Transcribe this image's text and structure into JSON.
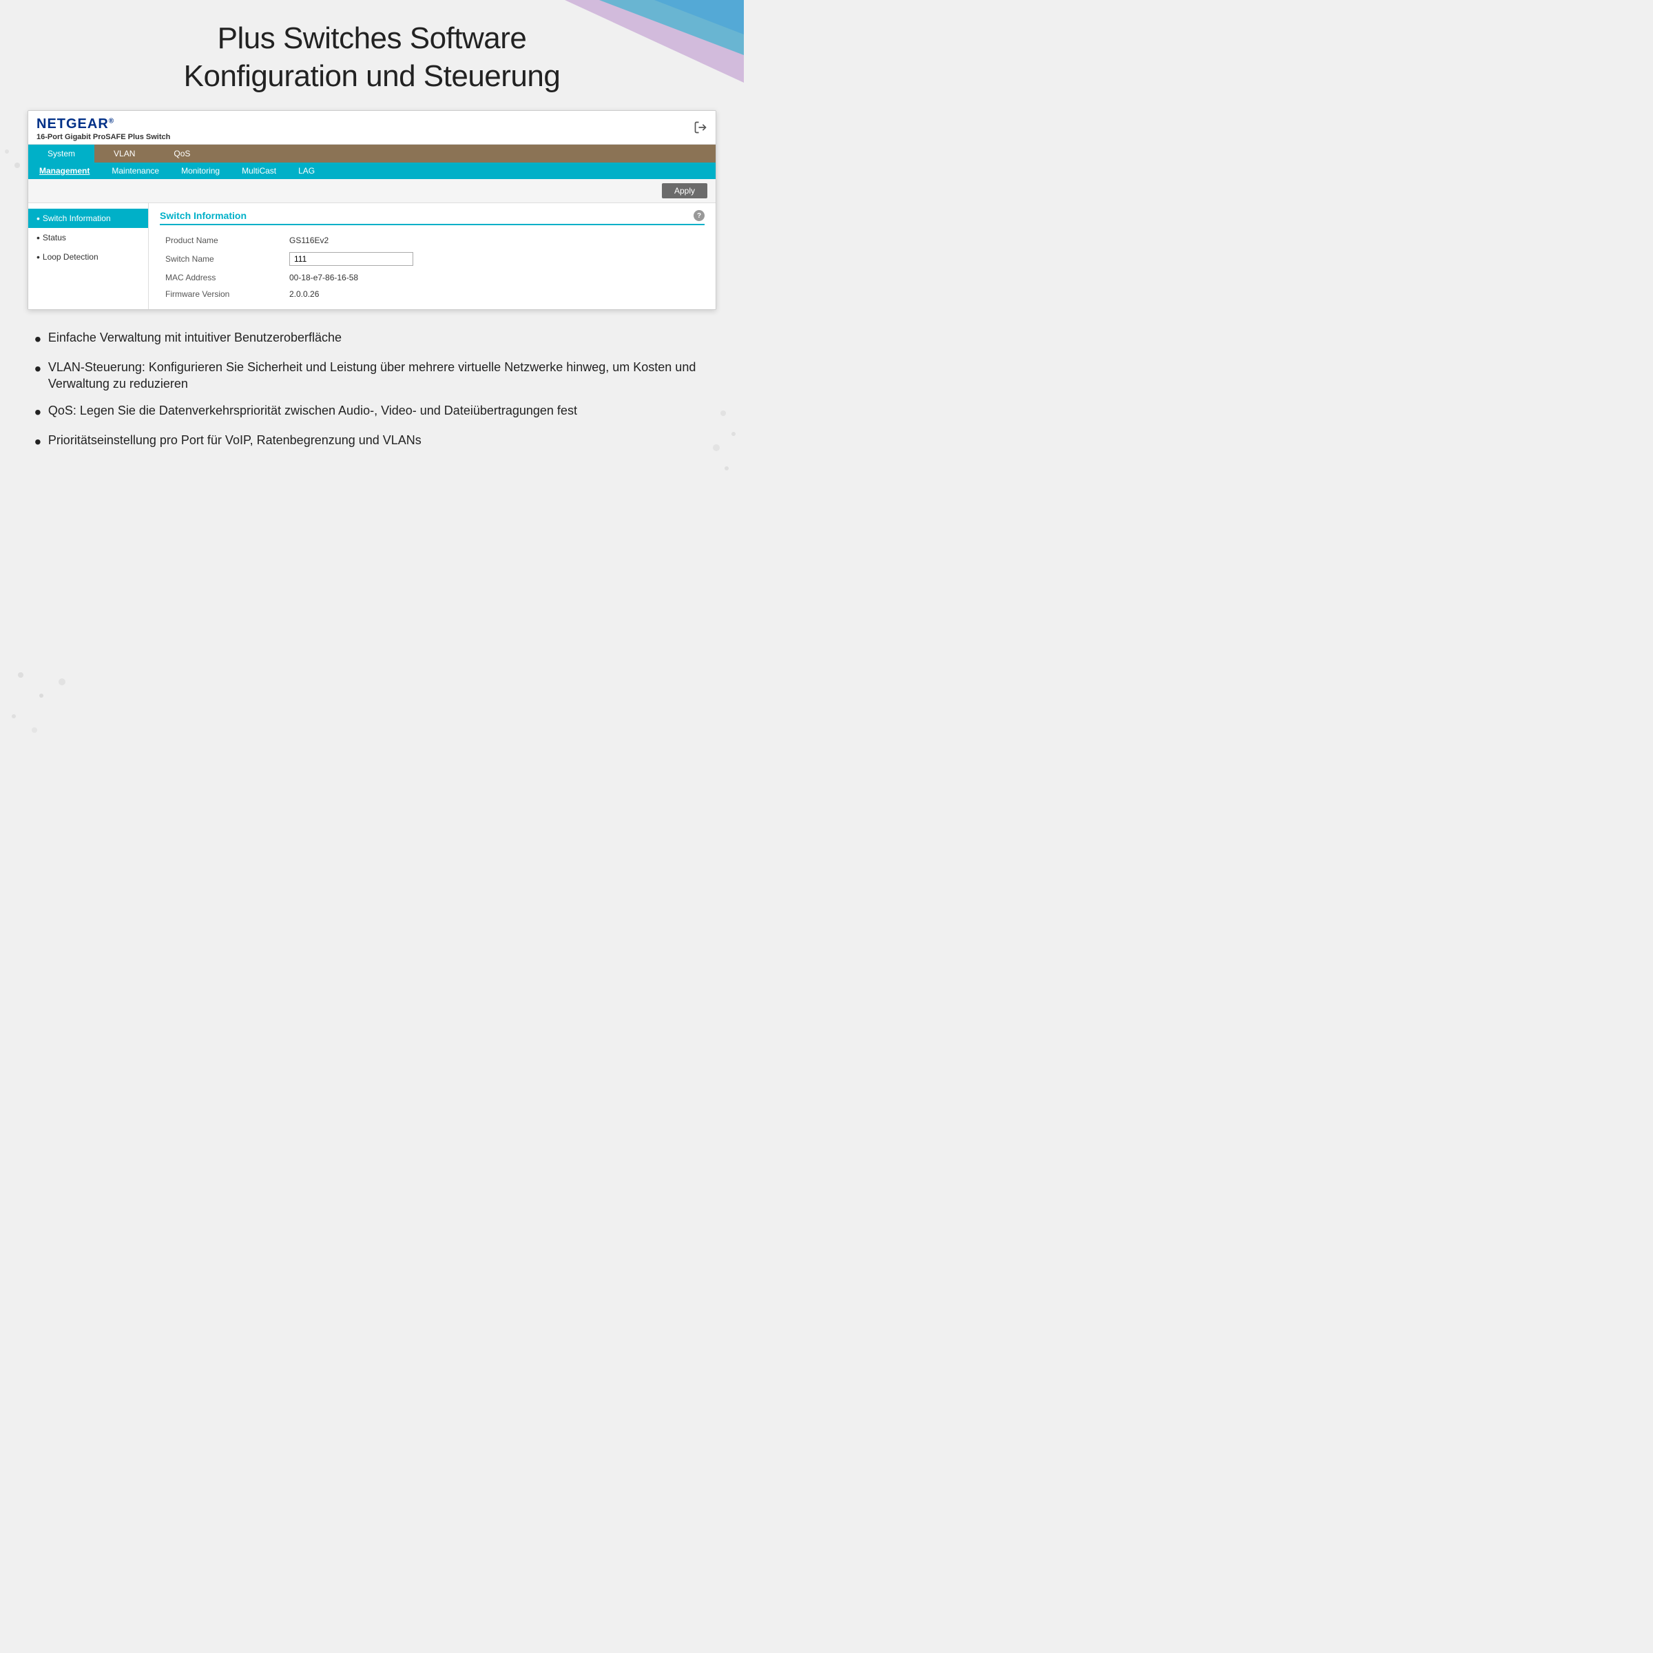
{
  "page": {
    "title_line1": "Plus Switches Software",
    "title_line2": "Konfiguration und Steuerung"
  },
  "app": {
    "brand": "NETGEAR",
    "brand_sup": "®",
    "device_name": "16-Port Gigabit ProSAFE Plus Switch",
    "logout_title": "Logout"
  },
  "nav": {
    "primary": [
      {
        "label": "System",
        "active": true
      },
      {
        "label": "VLAN",
        "active": false
      },
      {
        "label": "QoS",
        "active": false
      }
    ],
    "secondary": [
      {
        "label": "Management",
        "active": true
      },
      {
        "label": "Maintenance",
        "active": false
      },
      {
        "label": "Monitoring",
        "active": false
      },
      {
        "label": "MultiCast",
        "active": false
      },
      {
        "label": "LAG",
        "active": false
      }
    ]
  },
  "toolbar": {
    "apply_label": "Apply"
  },
  "sidebar": {
    "items": [
      {
        "label": "Switch Information",
        "active": true,
        "dot": "•"
      },
      {
        "label": "Status",
        "active": false,
        "dot": "•"
      },
      {
        "label": "Loop Detection",
        "active": false,
        "dot": "•"
      }
    ]
  },
  "info_panel": {
    "title": "Switch Information",
    "help_label": "?",
    "fields": [
      {
        "label": "Product Name",
        "value": "GS116Ev2",
        "type": "text"
      },
      {
        "label": "Switch Name",
        "value": "111",
        "type": "input"
      },
      {
        "label": "MAC Address",
        "value": "00-18-e7-86-16-58",
        "type": "text"
      },
      {
        "label": "Firmware Version",
        "value": "2.0.0.26",
        "type": "text"
      }
    ]
  },
  "bullets": [
    {
      "text": "Einfache Verwaltung mit intuitiver Benutzeroberfläche"
    },
    {
      "text": "VLAN-Steuerung: Konfigurieren Sie Sicherheit und Leistung über mehrere virtuelle Netzwerke hinweg, um Kosten und Verwaltung zu reduzieren"
    },
    {
      "text": "QoS: Legen Sie die Datenverkehrspriorität zwischen Audio-, Video- und Dateiübertragungen fest"
    },
    {
      "text": "Prioritätseinstellung pro Port für VoIP, Ratenbegrenzung und VLANs"
    }
  ],
  "colors": {
    "accent_cyan": "#00b0c8",
    "nav_brown": "#8b7355",
    "brand_blue": "#003087"
  }
}
